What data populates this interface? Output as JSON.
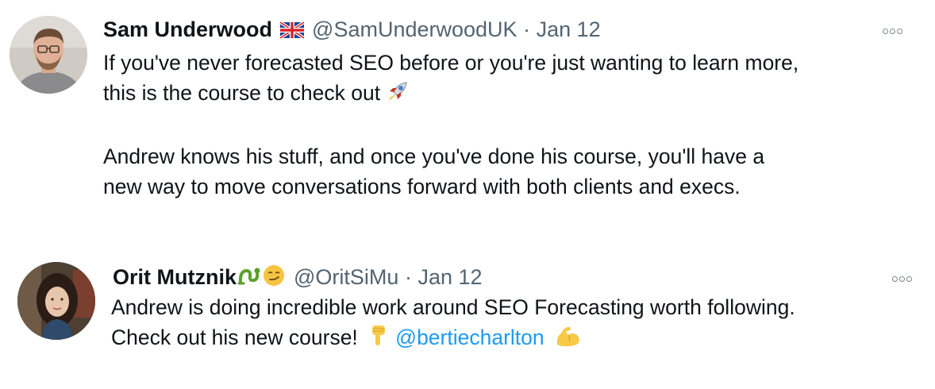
{
  "tweets": [
    {
      "author": "Sam Underwood",
      "flag_icon": "uk-flag-icon",
      "handle": "@SamUnderwoodUK",
      "separator": "·",
      "date": "Jan 12",
      "lines": [
        "If you've never forecasted SEO before or you're just wanting to learn more,",
        "this is the course to check out",
        "Andrew knows his stuff, and once you've done his course, you'll have a",
        "new way to move conversations forward with both clients and execs."
      ],
      "emoji": "rocket-icon"
    },
    {
      "author": "Orit Mutznik",
      "name_emojis": [
        "snake-icon",
        "smirk-face-icon"
      ],
      "handle": "@OritSiMu",
      "separator": "·",
      "date": "Jan 12",
      "lines": [
        "Andrew is doing incredible work around SEO Forecasting worth following.",
        "Check out his new course!"
      ],
      "mention": "@bertiecharlton",
      "emojis": [
        "pointing-down-icon",
        "flexed-biceps-icon"
      ]
    }
  ],
  "colors": {
    "text": "#0f1419",
    "muted": "#536471",
    "link": "#1d9bf0"
  }
}
